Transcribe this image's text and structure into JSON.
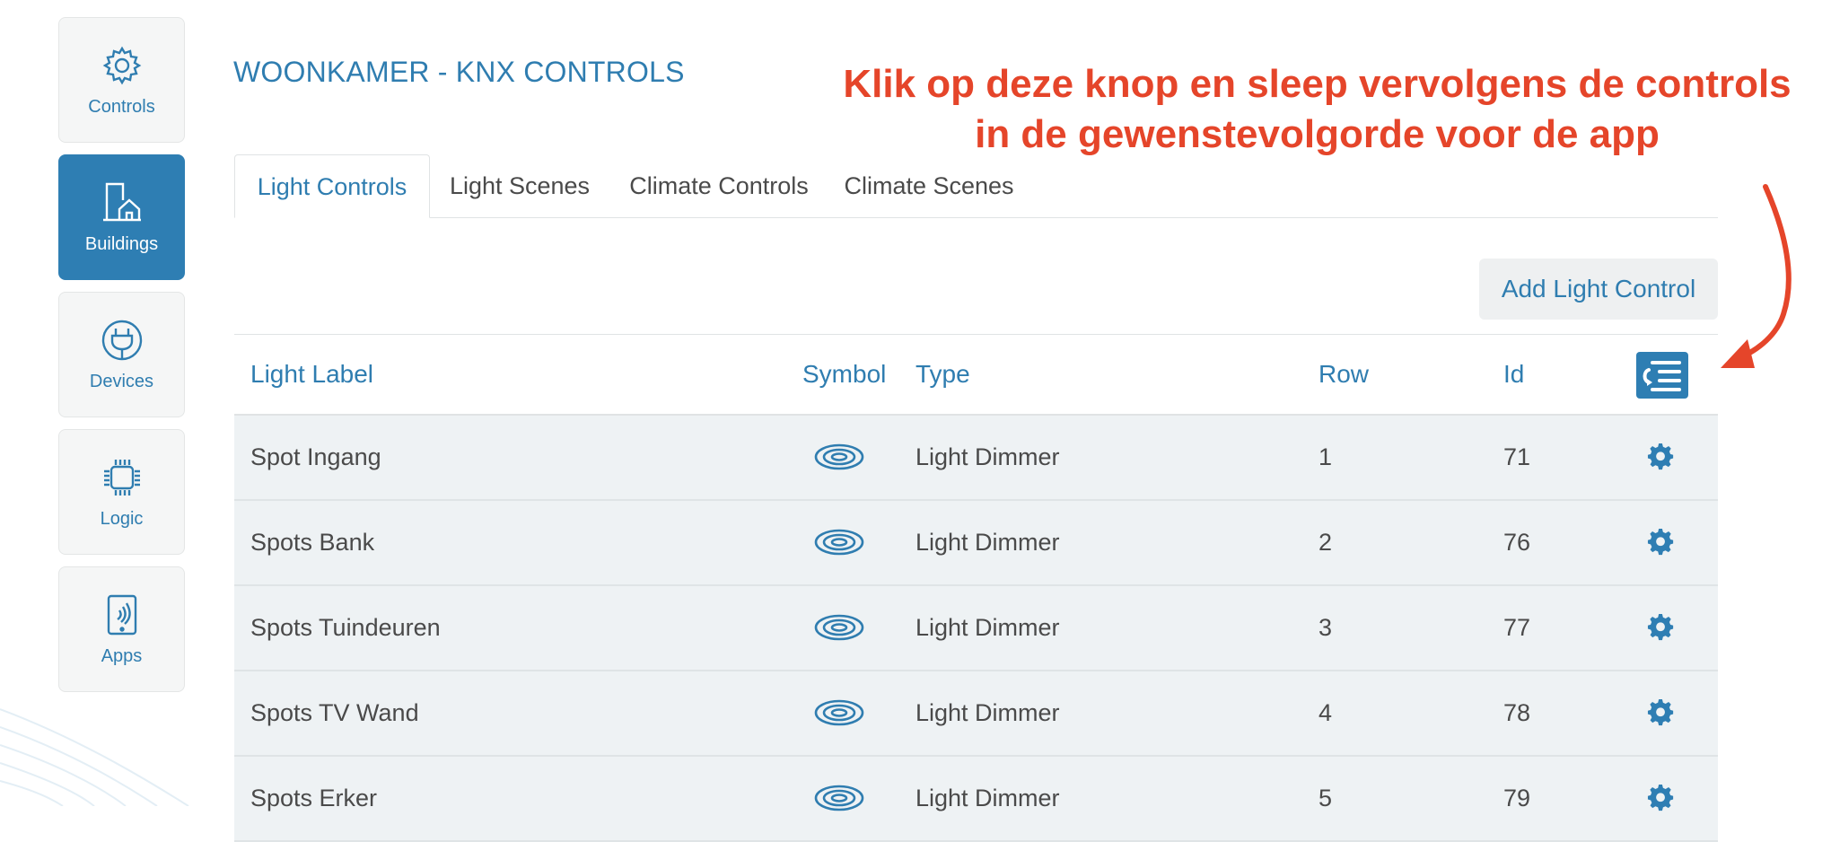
{
  "sidebar": {
    "items": [
      {
        "label": "Controls",
        "icon": "gear-icon",
        "active": false
      },
      {
        "label": "Buildings",
        "icon": "building-icon",
        "active": true
      },
      {
        "label": "Devices",
        "icon": "plug-icon",
        "active": false
      },
      {
        "label": "Logic",
        "icon": "chip-icon",
        "active": false
      },
      {
        "label": "Apps",
        "icon": "tablet-icon",
        "active": false
      }
    ]
  },
  "page": {
    "title": "WOONKAMER - KNX CONTROLS",
    "annotation_line1": "Klik op deze knop en sleep vervolgens de controls",
    "annotation_line2": "in de gewenstevolgorde voor de app",
    "annotation_color": "#e5452a"
  },
  "tabs": [
    {
      "label": "Light Controls",
      "active": true
    },
    {
      "label": "Light Scenes",
      "active": false
    },
    {
      "label": "Climate Controls",
      "active": false
    },
    {
      "label": "Climate Scenes",
      "active": false
    }
  ],
  "add_button_label": "Add Light Control",
  "table": {
    "headers": {
      "label": "Light Label",
      "symbol": "Symbol",
      "type": "Type",
      "row": "Row",
      "id": "Id"
    },
    "rows": [
      {
        "label": "Spot Ingang",
        "type": "Light Dimmer",
        "row": "1",
        "id": "71"
      },
      {
        "label": "Spots Bank",
        "type": "Light Dimmer",
        "row": "2",
        "id": "76"
      },
      {
        "label": "Spots Tuindeuren",
        "type": "Light Dimmer",
        "row": "3",
        "id": "77"
      },
      {
        "label": "Spots TV Wand",
        "type": "Light Dimmer",
        "row": "4",
        "id": "78"
      },
      {
        "label": "Spots Erker",
        "type": "Light Dimmer",
        "row": "5",
        "id": "79"
      }
    ]
  },
  "colors": {
    "accent": "#2e7eb3",
    "text": "#4a4a4a",
    "row_bg": "#eef2f4"
  }
}
